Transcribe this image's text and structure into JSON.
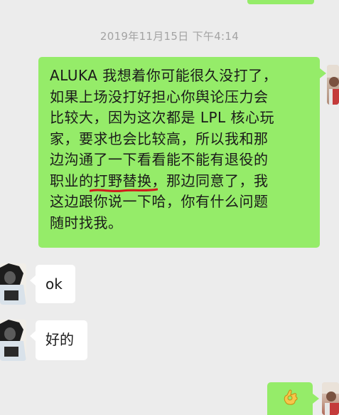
{
  "conversation": {
    "timestamp": "2019年11月15日 下午4:14",
    "messages": [
      {
        "sender": "self",
        "lines": [
          "ALUKA 我想着你可能很久没打了，",
          "如果上场没打好担心你舆论压力会",
          "比较大，因为这次都是 LPL 核心玩",
          "家，要求也会比较高，所以我和那",
          "边沟通了一下看看能不能有退役的"
        ],
        "line6_before": "职业的",
        "line6_highlight": "打野替换",
        "line6_after": "，那边同意了，我",
        "line7": "这边跟你说一下哈，你有什么问题",
        "line8": "随时找我。"
      },
      {
        "sender": "contact",
        "text": "ok"
      },
      {
        "sender": "contact",
        "text": "好的"
      },
      {
        "sender": "self",
        "emoji": "ok-hand-emoji"
      }
    ]
  },
  "colors": {
    "sent_bubble": "#95ec69",
    "received_bubble": "#ffffff",
    "background": "#ececec",
    "timestamp_text": "#a3a3a3",
    "highlight_mark": "#d11a1a"
  }
}
